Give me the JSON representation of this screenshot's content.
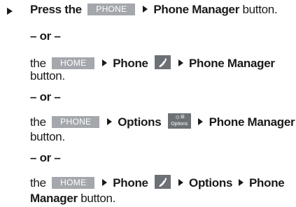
{
  "step1": {
    "press_the": "Press the",
    "phone_key": "PHONE",
    "phone_manager": "Phone Manager",
    "button": "button."
  },
  "or1": "– or –",
  "step2": {
    "the": "the",
    "home_key": "HOME",
    "phone": "Phone",
    "phone_manager": "Phone Manager",
    "button": "button."
  },
  "or2": "– or –",
  "step3": {
    "the": "the",
    "phone_key": "PHONE",
    "options": "Options",
    "options_icon_label": "Options",
    "phone_manager": "Phone Manager",
    "button": "button."
  },
  "or3": "– or –",
  "step4": {
    "the": "the",
    "home_key": "HOME",
    "phone": "Phone",
    "options": "Options",
    "manager": "Manager",
    "button": "button."
  },
  "icons": {
    "bullet": "triangle-bullet-icon",
    "arrow": "arrow-right-icon",
    "phone": "phone-handset-icon",
    "options": "options-settings-icon"
  },
  "colors": {
    "key_bg": "#a4a7ab",
    "icon_bg": "#6d7175",
    "text": "#1a1a1a"
  }
}
